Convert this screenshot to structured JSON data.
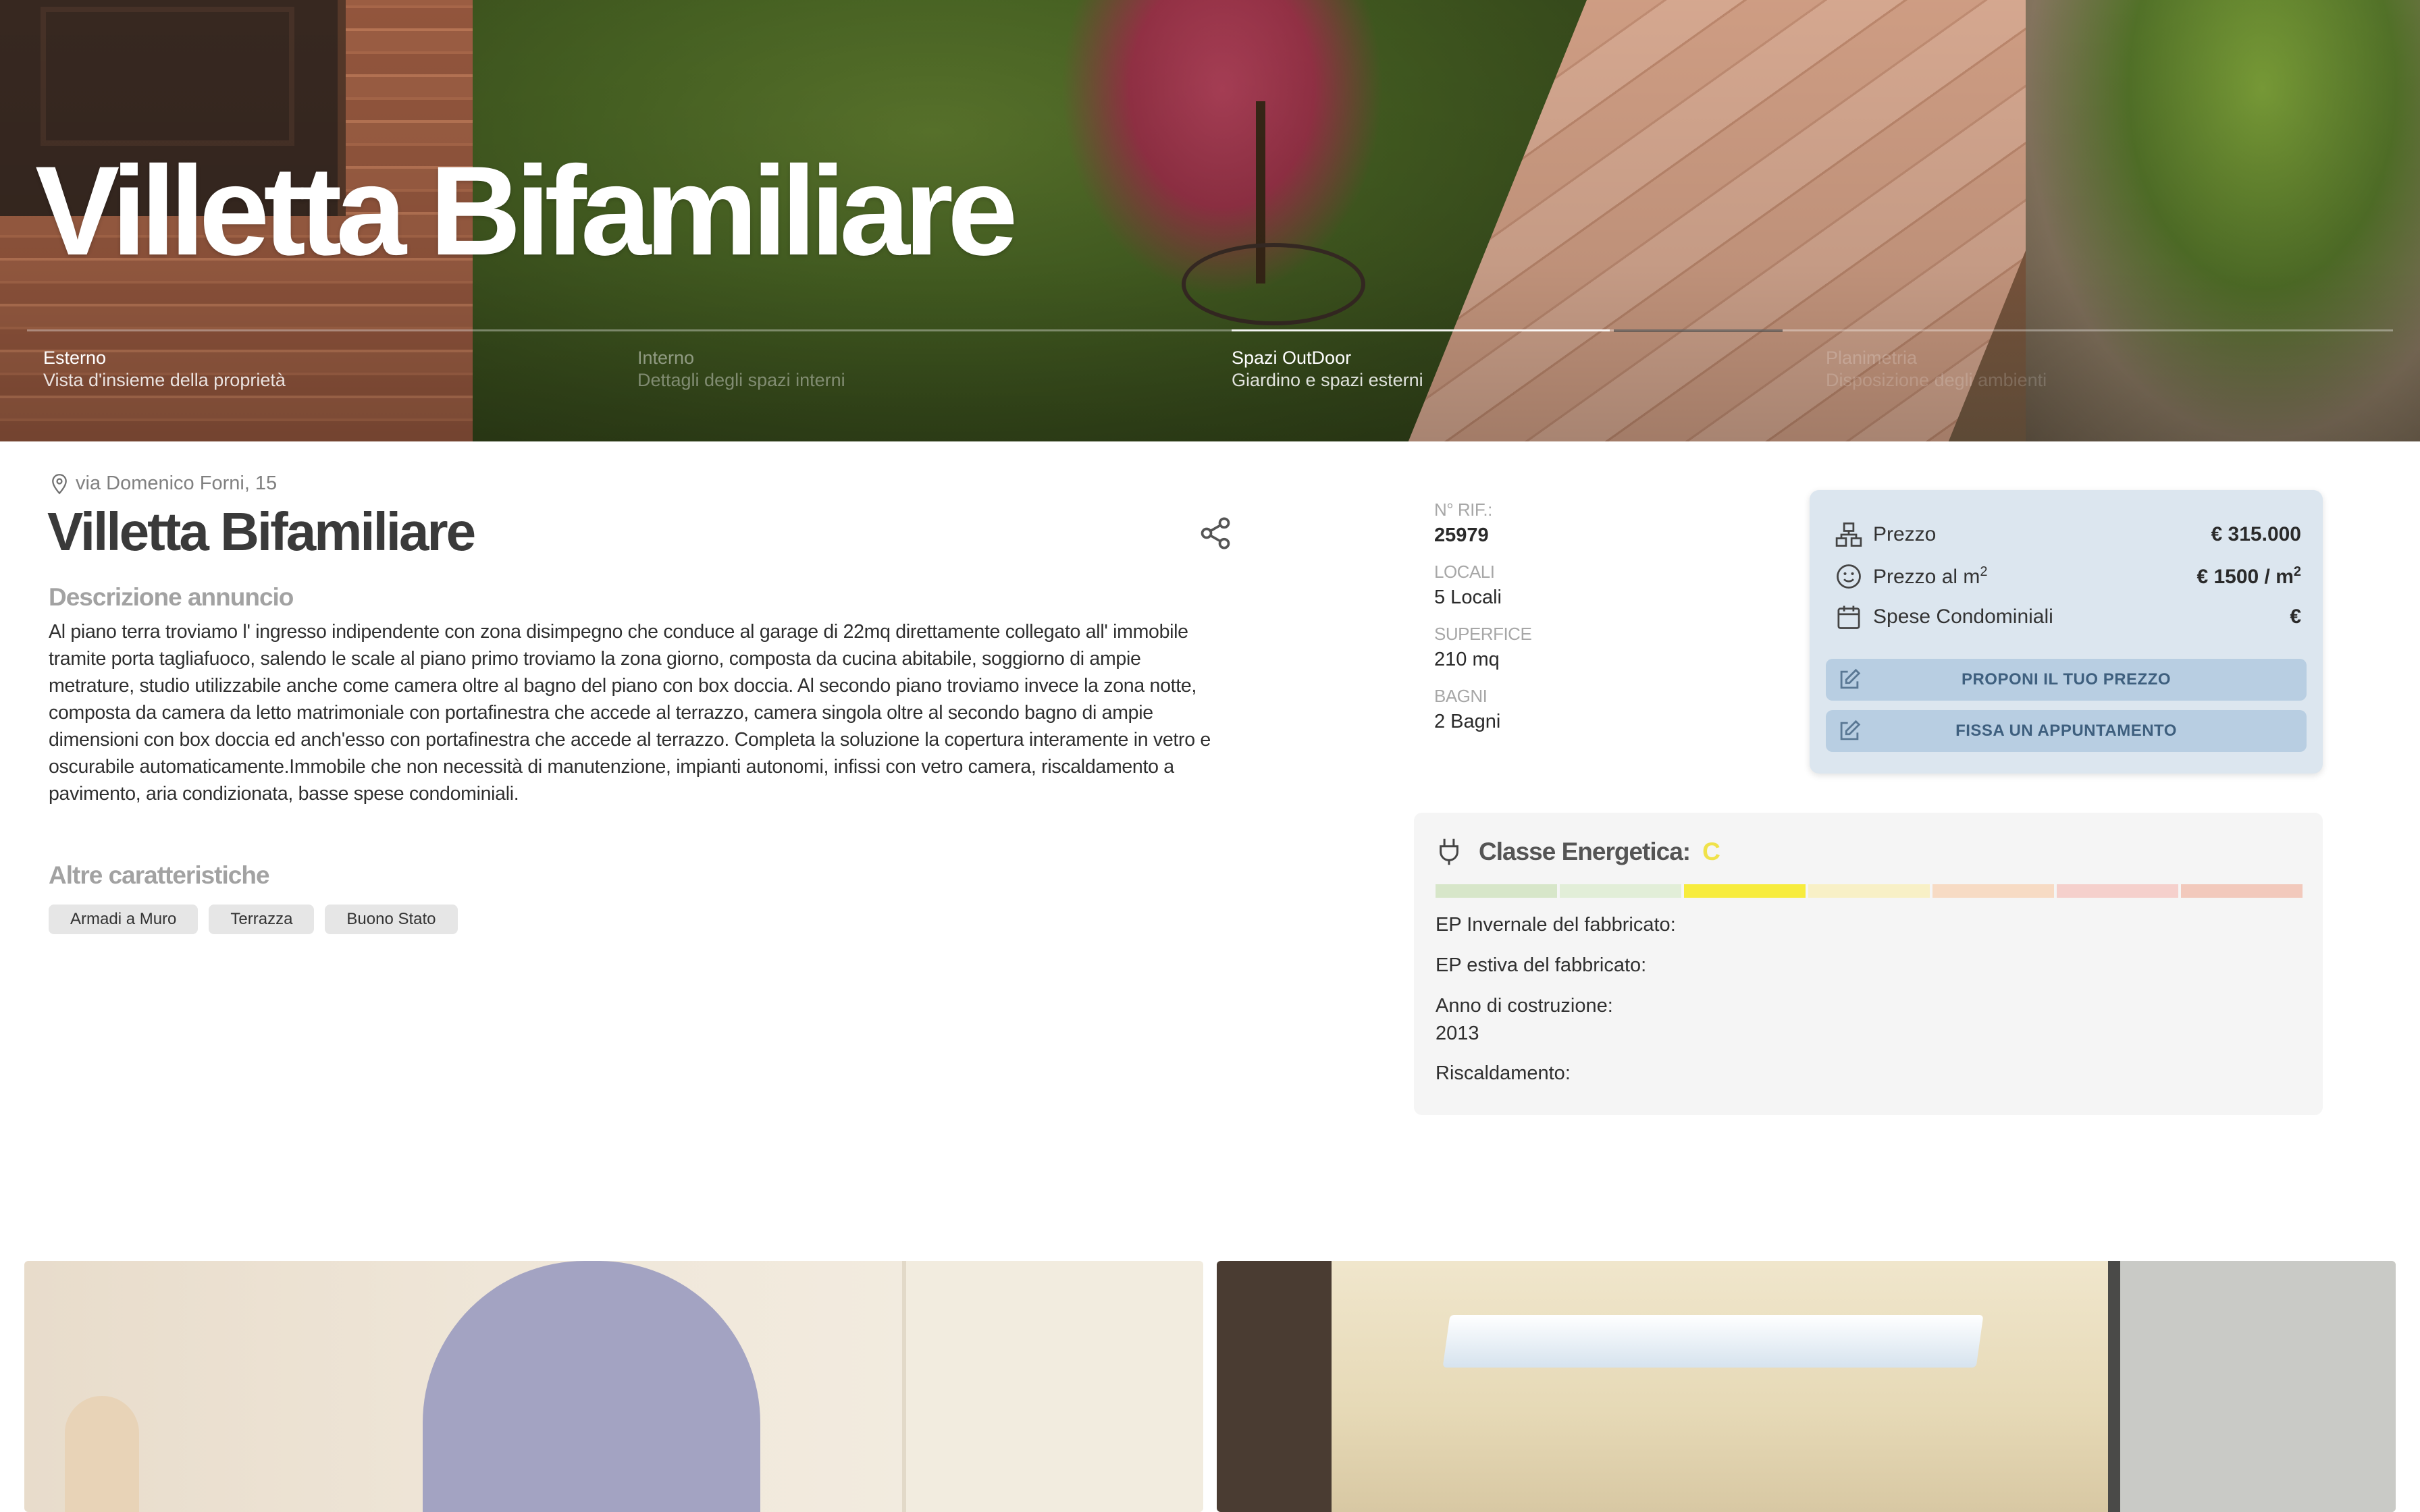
{
  "hero": {
    "title": "Villetta Bifamiliare",
    "slides": [
      {
        "title": "Esterno",
        "subtitle": "Vista d'insieme della proprietà"
      },
      {
        "title": "Interno",
        "subtitle": "Dettagli degli spazi interni"
      },
      {
        "title": "Spazi OutDoor",
        "subtitle": "Giardino e spazi esterni"
      },
      {
        "title": "Planimetria",
        "subtitle": "Disposizione degli ambienti"
      }
    ]
  },
  "listing": {
    "address": "via Domenico Forni, 15",
    "title": "Villetta Bifamiliare",
    "description_heading": "Descrizione annuncio",
    "description": "Al piano terra troviamo l' ingresso indipendente con zona disimpegno che conduce al garage di 22mq direttamente collegato all' immobile tramite porta tagliafuoco, salendo le scale al piano primo troviamo la zona giorno, composta da cucina abitabile, soggiorno di ampie metrature, studio utilizzabile anche come camera oltre al bagno del piano con box doccia. Al secondo piano troviamo invece la zona notte, composta da camera da letto matrimoniale con portafinestra che accede al terrazzo, camera singola oltre al secondo bagno di ampie dimensioni con box doccia ed anch'esso con portafinestra che accede al terrazzo. Completa la soluzione la copertura interamente in vetro e oscurabile automaticamente.Immobile che non necessità di manutenzione, impianti autonomi, infissi con vetro camera, riscaldamento a pavimento, aria condizionata, basse spese condominiali.",
    "features_heading": "Altre caratteristiche",
    "features": [
      "Armadi a Muro",
      "Terrazza",
      "Buono Stato"
    ]
  },
  "facts": {
    "rif_label": "N° RIF.:",
    "rif_value": "25979",
    "locali_label": "LOCALI",
    "locali_value": "5 Locali",
    "superficie_label": "SUPERFICE",
    "superficie_value": "210 mq",
    "bagni_label": "BAGNI",
    "bagni_value": "2 Bagni"
  },
  "price": {
    "prezzo_label": "Prezzo",
    "prezzo_value": "€ 315.000",
    "mq_label": "Prezzo al m",
    "mq_value": "€ 1500  / m",
    "sup": "2",
    "spese_label": "Spese Condominiali",
    "spese_value": "€",
    "btn_offer": "PROPONI IL TUO PREZZO",
    "btn_appointment": "FISSA UN APPUNTAMENTO",
    "icons": [
      "sitemap-icon",
      "smiley-icon",
      "calendar-icon",
      "edit-icon"
    ]
  },
  "energy": {
    "label": "Classe Energetica:",
    "class": "C",
    "scale_colors": [
      "#d7e6c9",
      "#e2eed8",
      "#f7ec3d",
      "#f8f0c6",
      "#f7dbc4",
      "#f5d0cc",
      "#f2c9bc"
    ],
    "ep_inv_label": "EP Invernale del fabbricato:",
    "ep_est_label": "EP estiva del fabbricato:",
    "anno_label": "Anno di costruzione:",
    "anno_value": "2013",
    "risc_label": "Riscaldamento:"
  },
  "colors": {
    "price_card_bg": "#dce6ef",
    "button_bg": "#b8cee2",
    "button_text": "#3e5f7e",
    "energy_class": "#f0e24a"
  }
}
